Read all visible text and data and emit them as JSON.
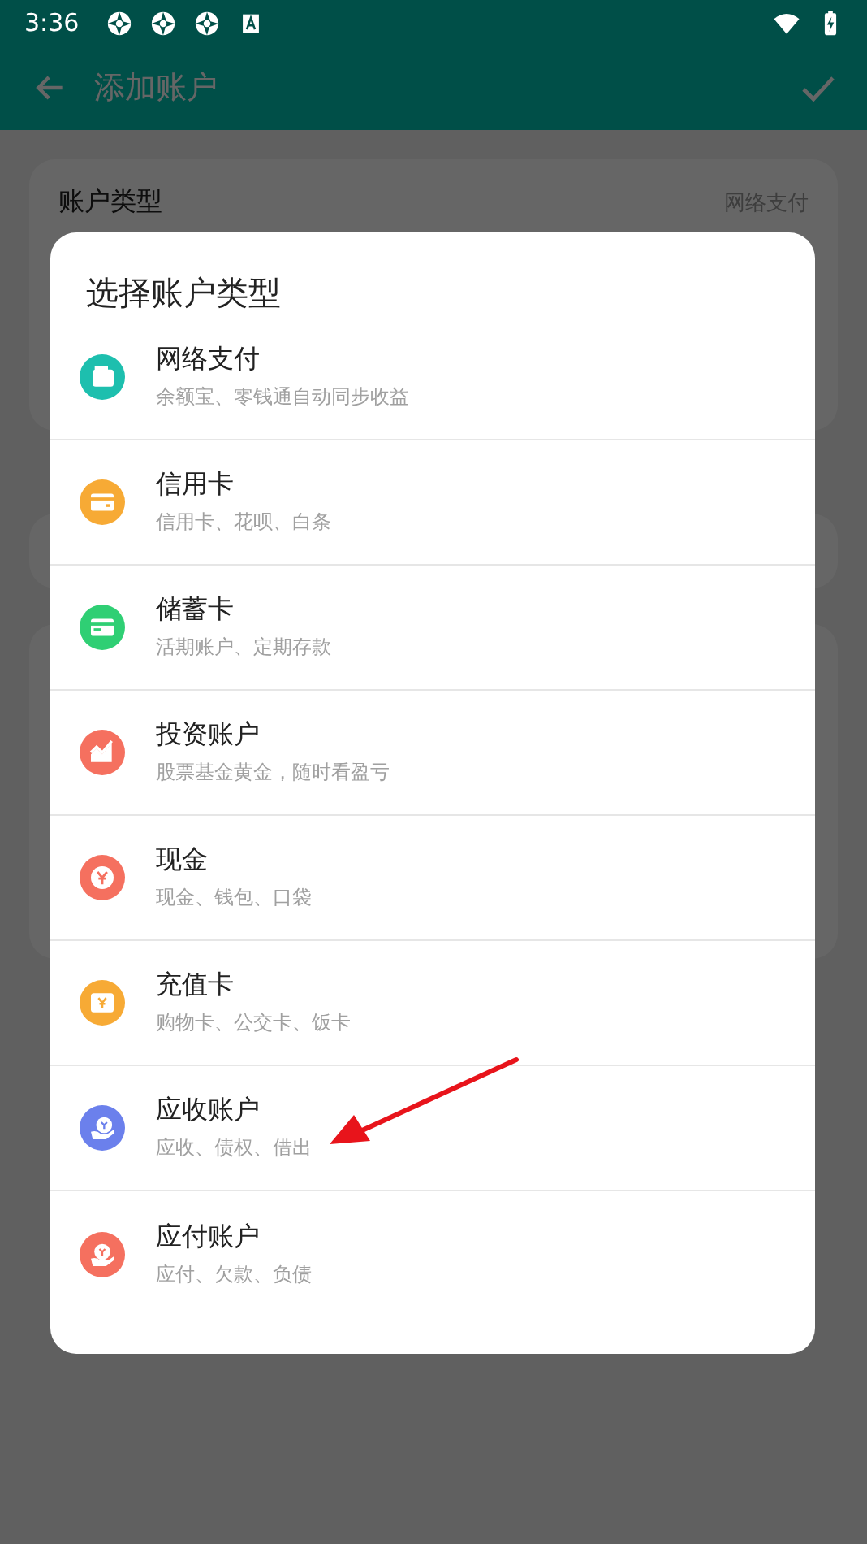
{
  "status_bar": {
    "time": "3:36"
  },
  "toolbar": {
    "title": "添加账户"
  },
  "form": {
    "account_type": {
      "label": "账户类型",
      "value": "网络支付"
    }
  },
  "dialog": {
    "title": "选择账户类型",
    "items": [
      {
        "kind": "wallet",
        "color": "#1dbfae",
        "title": "网络支付",
        "subtitle": "余额宝、零钱通自动同步收益"
      },
      {
        "kind": "card",
        "color": "#f7aa35",
        "title": "信用卡",
        "subtitle": "信用卡、花呗、白条"
      },
      {
        "kind": "debit",
        "color": "#2fcf74",
        "title": "储蓄卡",
        "subtitle": "活期账户、定期存款"
      },
      {
        "kind": "chart",
        "color": "#f5705f",
        "title": "投资账户",
        "subtitle": "股票基金黄金，随时看盈亏"
      },
      {
        "kind": "cash",
        "color": "#f5705f",
        "title": "现金",
        "subtitle": "现金、钱包、口袋"
      },
      {
        "kind": "prepaid",
        "color": "#f7aa35",
        "title": "充值卡",
        "subtitle": "购物卡、公交卡、饭卡"
      },
      {
        "kind": "receivable",
        "color": "#6b80ec",
        "title": "应收账户",
        "subtitle": "应收、债权、借出"
      },
      {
        "kind": "payable",
        "color": "#f5705f",
        "title": "应付账户",
        "subtitle": "应付、欠款、负债"
      }
    ]
  }
}
